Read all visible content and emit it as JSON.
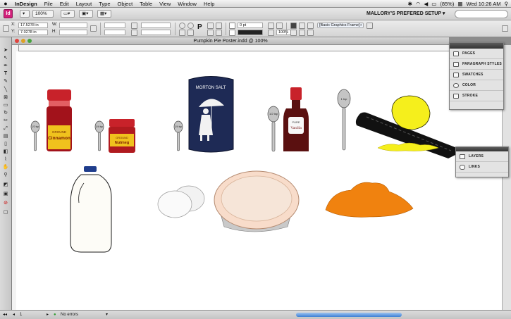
{
  "menubar": {
    "apple": "",
    "app": "InDesign",
    "items": [
      "File",
      "Edit",
      "Layout",
      "Type",
      "Object",
      "Table",
      "View",
      "Window",
      "Help"
    ],
    "battery": "(85%)",
    "clock": "Wed 10:26 AM"
  },
  "appbar": {
    "logo": "Id",
    "zoom": "100%",
    "workspace": "MALLORY'S PREFERED SETUP ▾"
  },
  "control": {
    "x_label": "X:",
    "x_value": "17.5278 in",
    "y_label": "Y:",
    "y_value": "7.0278 in",
    "w_label": "W:",
    "h_label": "H:",
    "stroke_weight": "0 pt",
    "scale": "100%",
    "frame_style": "[Basic Graphics Frame]+"
  },
  "document": {
    "title": "Pumpkin Pie Poster.indd @ 100%"
  },
  "labels": {
    "cinnamon_top": "GROUND",
    "cinnamon": "Cinnamon",
    "nutmeg_top": "GROUND",
    "nutmeg": "Nutmeg",
    "salt_brand": "MORTON SALT",
    "vanilla_top": "PURE",
    "vanilla": "Vanilla",
    "spoon_1": "1/2 tsp",
    "spoon_2": "1/4 tsp",
    "spoon_3": "1/4 tsp",
    "spoon_4": "1/2 tsp",
    "spoon_5": "1 tsp"
  },
  "panels": {
    "main": [
      "PAGES",
      "PARAGRAPH STYLES",
      "SWATCHES",
      "COLOR",
      "STROKE"
    ],
    "secondary": [
      "LAYERS",
      "LINKS"
    ]
  },
  "statusbar": {
    "page": "1",
    "errors": "No errors"
  },
  "colors": {
    "accent": "#d1207a",
    "cinnamon_label": "#f0c21d",
    "jar_red": "#c8222a",
    "salt_blue": "#1e2a55",
    "vanilla_brown": "#5a1010",
    "lemon": "#f5ef1c",
    "pumpkin": "#f0820f",
    "pie_crust": "#f8dcca"
  }
}
